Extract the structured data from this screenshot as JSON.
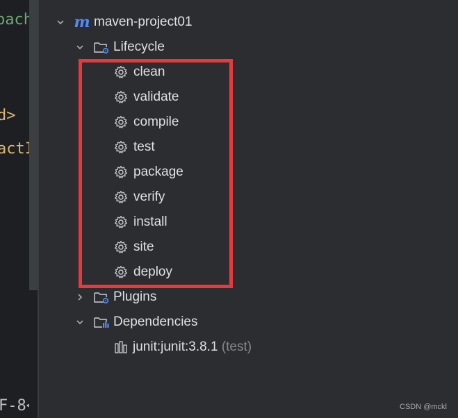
{
  "editor": {
    "fragments": [
      "pach",
      "d>",
      "actI",
      "F-8<"
    ]
  },
  "project": {
    "name": "maven-project01",
    "icon_letter": "m",
    "icon": "maven-icon"
  },
  "lifecycle": {
    "label": "Lifecycle",
    "icon": "folder-gear-icon",
    "phases": [
      "clean",
      "validate",
      "compile",
      "test",
      "package",
      "verify",
      "install",
      "site",
      "deploy"
    ]
  },
  "plugins": {
    "label": "Plugins",
    "icon": "folder-gear-icon"
  },
  "dependencies": {
    "label": "Dependencies",
    "icon": "folder-library-icon",
    "items": [
      {
        "name": "junit:junit:3.8.1",
        "scope": "(test)"
      }
    ]
  },
  "colors": {
    "background": "#2b2d30",
    "text": "#dfe1e5",
    "accent": "#548af7",
    "highlight_border": "#e8393c"
  },
  "watermark": "CSDN @mckl"
}
